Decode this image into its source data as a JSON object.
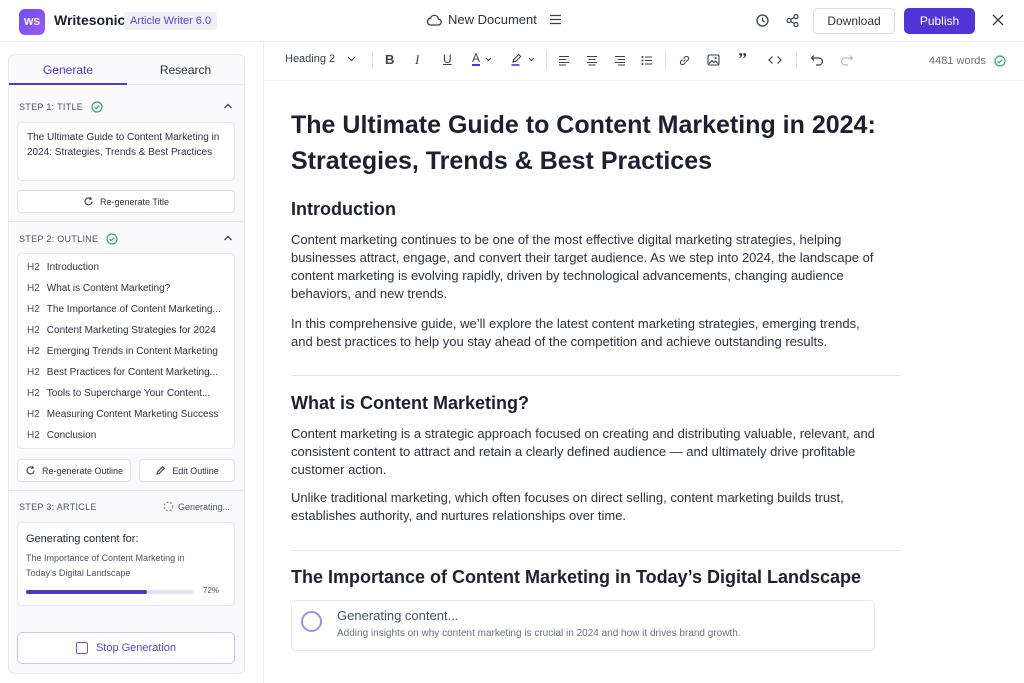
{
  "app": {
    "logo_text": "WS",
    "name": "Writesonic",
    "badge": "Article Writer 6.0",
    "document_name": "New Document",
    "download_label": "Download",
    "publish_label": "Publish",
    "accent_color": "#5334d6"
  },
  "sidebar": {
    "tabs": [
      "Generate",
      "Research"
    ],
    "step1": {
      "label": "STEP 1: TITLE",
      "title_text": "The Ultimate Guide to Content Marketing in 2024: Strategies, Trends & Best Practices",
      "regenerate_label": "Re-generate Title"
    },
    "step2": {
      "label": "STEP 2: OUTLINE",
      "heading_tag": "H2",
      "items": [
        "Introduction",
        "What is Content Marketing?",
        "The Importance of Content Marketing...",
        "Content Marketing Strategies for 2024",
        "Emerging Trends in Content Marketing",
        "Best Practices for Content Marketing...",
        "Tools to Supercharge Your Content...",
        "Measuring Content Marketing Success",
        "Conclusion"
      ],
      "regenerate_label": "Re-generate Outline",
      "edit_label": "Edit Outline"
    },
    "step3": {
      "label": "STEP 3: ARTICLE",
      "status": "Generating...",
      "generating_for_label": "Generating content for:",
      "section_name": "The Importance of Content Marketing in Today’s Digital Landscape",
      "progress_fraction": 0.72,
      "progress_label": "72%"
    },
    "stop_label": "Stop Generation"
  },
  "toolbar": {
    "block_style": "Heading 2",
    "word_count": "4481 words"
  },
  "article": {
    "title": "The Ultimate Guide to Content Marketing in 2024: Strategies, Trends & Best Practices",
    "sections": [
      {
        "heading": "Introduction",
        "paragraphs": [
          "Content marketing continues to be one of the most effective digital marketing strategies, helping businesses attract, engage, and convert their target audience. As we step into 2024, the landscape of content marketing is evolving rapidly, driven by technological advancements, changing audience behaviors, and new trends.",
          "In this comprehensive guide, we’ll explore the latest content marketing strategies, emerging trends, and best practices to help you stay ahead of the competition and achieve outstanding results."
        ]
      },
      {
        "heading": "What is Content Marketing?",
        "paragraphs": [
          "Content marketing is a strategic approach focused on creating and distributing valuable, relevant, and consistent content to attract and retain a clearly defined audience — and ultimately drive profitable customer action.",
          "Unlike traditional marketing, which often focuses on direct selling, content marketing builds trust, establishes authority, and nurtures relationships over time."
        ]
      },
      {
        "heading": "The Importance of Content Marketing in Today’s Digital Landscape"
      }
    ],
    "generating": {
      "title": "Generating content...",
      "detail": "Adding insights on why content marketing is crucial in 2024 and how it drives brand growth."
    }
  }
}
